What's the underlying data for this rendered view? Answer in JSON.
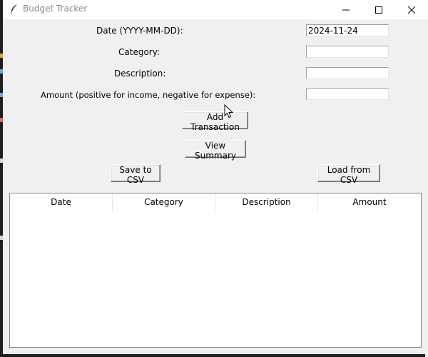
{
  "window": {
    "title": "Budget Tracker",
    "app_icon": "feather-icon",
    "controls": [
      "minimize-icon",
      "maximize-icon",
      "close-icon"
    ]
  },
  "form": {
    "date_label": "Date (YYYY-MM-DD):",
    "date_value": "2024-11-24",
    "category_label": "Category:",
    "category_value": "",
    "description_label": "Description:",
    "description_value": "",
    "amount_label": "Amount (positive for income, negative for expense):",
    "amount_value": ""
  },
  "buttons": {
    "add": "Add Transaction",
    "summary": "View Summary",
    "save": "Save to CSV",
    "load": "Load from CSV"
  },
  "table": {
    "columns": [
      "Date",
      "Category",
      "Description",
      "Amount"
    ],
    "rows": []
  },
  "colors": {
    "window_bg": "#f0f0f0",
    "titlebar_bg": "#ffffff",
    "title_text": "#8a8a8a"
  }
}
